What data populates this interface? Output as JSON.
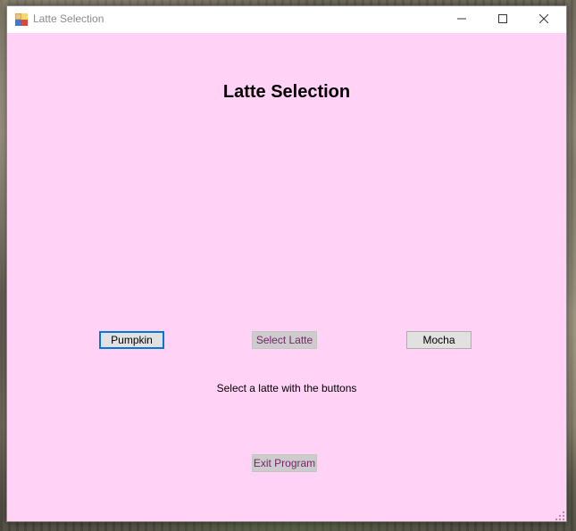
{
  "window": {
    "title": "Latte Selection",
    "title_color": "#8a8a8a",
    "client_background": "#ffd2f6",
    "icon": "winforms-app-icon",
    "controls": [
      "minimize-icon",
      "maximize-icon",
      "close-icon"
    ]
  },
  "form": {
    "heading": "Latte Selection",
    "buttons": {
      "pumpkin": "Pumpkin",
      "select_latte": "Select Latte",
      "mocha": "Mocha",
      "exit": "Exit Program"
    },
    "status": "Select a latte with the buttons"
  },
  "colors": {
    "focus_border": "#0078d7",
    "disabled_text": "#7a1f6b"
  }
}
